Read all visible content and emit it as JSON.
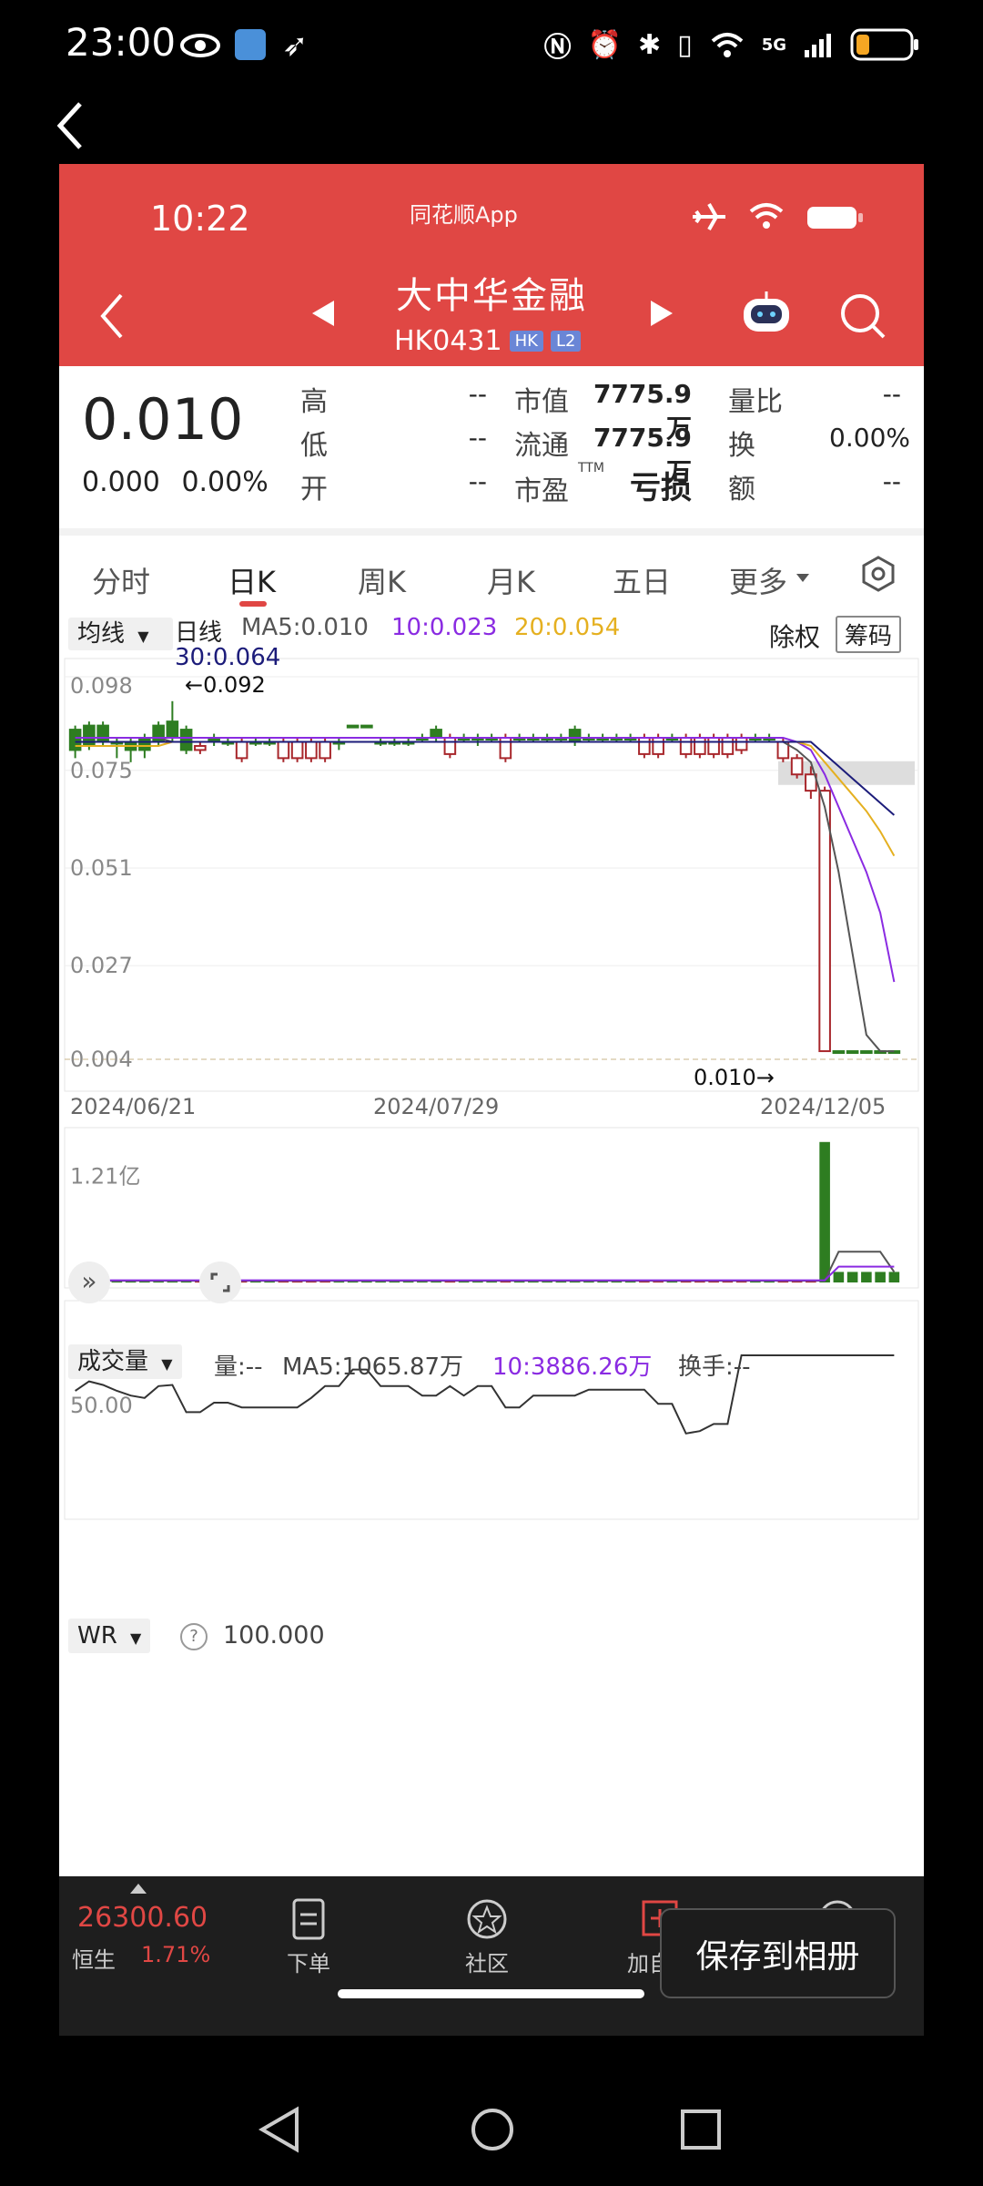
{
  "outer_status": {
    "time": "23:00",
    "network": "5G"
  },
  "inner_status": {
    "time": "10:22",
    "brand": "同花顺App"
  },
  "stock": {
    "name": "大中华金融",
    "code": "HK0431",
    "tag_market": "HK",
    "tag_level": "L2"
  },
  "quote": {
    "price": "0.010",
    "change": "0.000",
    "change_pct": "0.00%",
    "high_label": "高",
    "high_value": "--",
    "low_label": "低",
    "low_value": "--",
    "open_label": "开",
    "open_value": "--",
    "mcap_label": "市值",
    "mcap_value": "7775.9万",
    "float_label": "流通",
    "float_value": "7775.9万",
    "pe_label": "市盈",
    "pe_sup": "TTM",
    "pe_value": "亏损",
    "vr_label": "量比",
    "vr_value": "--",
    "turnover_label": "换",
    "turnover_value": "0.00%",
    "amount_label": "额",
    "amount_value": "--"
  },
  "tabs": [
    {
      "label": "分时"
    },
    {
      "label": "日K"
    },
    {
      "label": "周K"
    },
    {
      "label": "月K"
    },
    {
      "label": "五日"
    },
    {
      "label": "更多"
    }
  ],
  "chart_header": {
    "ma_select": "均线",
    "period": "日线",
    "ma5": "MA5:0.010",
    "ma10": "10:0.023",
    "ma20": "20:0.054",
    "ma30": "30:0.064",
    "exright": "除权",
    "chips": "筹码"
  },
  "vol_header": {
    "select": "成交量",
    "vol": "量:--",
    "ma5": "MA5:1065.87万",
    "ma10": "10:3886.26万",
    "turnover": "换手:--"
  },
  "wr_header": {
    "select": "WR",
    "help": "?",
    "value": "100.000"
  },
  "chart_data": [
    {
      "type": "candlestick",
      "title": "日线",
      "y_ticks": [
        "0.098",
        "0.075",
        "0.051",
        "0.027",
        "0.004"
      ],
      "x_ticks": [
        "2024/06/21",
        "2024/07/29",
        "2024/12/05"
      ],
      "ylim": [
        0.004,
        0.098
      ],
      "annotations": {
        "max": "←0.092",
        "last": "0.010→"
      },
      "candles": [
        {
          "o": 0.08,
          "c": 0.085,
          "h": 0.086,
          "l": 0.078
        },
        {
          "o": 0.081,
          "c": 0.086,
          "h": 0.087,
          "l": 0.08
        },
        {
          "o": 0.082,
          "c": 0.086,
          "h": 0.087,
          "l": 0.081
        },
        {
          "o": 0.082,
          "c": 0.082,
          "h": 0.083,
          "l": 0.078
        },
        {
          "o": 0.08,
          "c": 0.082,
          "h": 0.083,
          "l": 0.077
        },
        {
          "o": 0.08,
          "c": 0.083,
          "h": 0.084,
          "l": 0.078
        },
        {
          "o": 0.082,
          "c": 0.086,
          "h": 0.087,
          "l": 0.081
        },
        {
          "o": 0.083,
          "c": 0.087,
          "h": 0.092,
          "l": 0.082
        },
        {
          "o": 0.08,
          "c": 0.085,
          "h": 0.086,
          "l": 0.079
        },
        {
          "o": 0.081,
          "c": 0.08,
          "h": 0.082,
          "l": 0.079
        },
        {
          "o": 0.082,
          "c": 0.083,
          "h": 0.084,
          "l": 0.081
        },
        {
          "o": 0.082,
          "c": 0.082,
          "h": 0.083,
          "l": 0.081
        },
        {
          "o": 0.082,
          "c": 0.078,
          "h": 0.083,
          "l": 0.077
        },
        {
          "o": 0.082,
          "c": 0.082,
          "h": 0.083,
          "l": 0.081
        },
        {
          "o": 0.082,
          "c": 0.082,
          "h": 0.083,
          "l": 0.081
        },
        {
          "o": 0.082,
          "c": 0.078,
          "h": 0.083,
          "l": 0.077
        },
        {
          "o": 0.082,
          "c": 0.078,
          "h": 0.083,
          "l": 0.077
        },
        {
          "o": 0.082,
          "c": 0.078,
          "h": 0.083,
          "l": 0.077
        },
        {
          "o": 0.082,
          "c": 0.078,
          "h": 0.083,
          "l": 0.077
        },
        {
          "o": 0.082,
          "c": 0.082,
          "h": 0.083,
          "l": 0.08
        },
        {
          "o": 0.086,
          "c": 0.086,
          "h": 0.086,
          "l": 0.086
        },
        {
          "o": 0.086,
          "c": 0.086,
          "h": 0.086,
          "l": 0.086
        },
        {
          "o": 0.082,
          "c": 0.082,
          "h": 0.083,
          "l": 0.081
        },
        {
          "o": 0.082,
          "c": 0.082,
          "h": 0.083,
          "l": 0.081
        },
        {
          "o": 0.082,
          "c": 0.082,
          "h": 0.083,
          "l": 0.081
        },
        {
          "o": 0.083,
          "c": 0.083,
          "h": 0.084,
          "l": 0.082
        },
        {
          "o": 0.083,
          "c": 0.085,
          "h": 0.086,
          "l": 0.082
        },
        {
          "o": 0.083,
          "c": 0.079,
          "h": 0.084,
          "l": 0.078
        },
        {
          "o": 0.083,
          "c": 0.083,
          "h": 0.084,
          "l": 0.082
        },
        {
          "o": 0.083,
          "c": 0.083,
          "h": 0.084,
          "l": 0.081
        },
        {
          "o": 0.083,
          "c": 0.083,
          "h": 0.084,
          "l": 0.082
        },
        {
          "o": 0.083,
          "c": 0.078,
          "h": 0.084,
          "l": 0.077
        },
        {
          "o": 0.083,
          "c": 0.083,
          "h": 0.084,
          "l": 0.082
        },
        {
          "o": 0.083,
          "c": 0.083,
          "h": 0.084,
          "l": 0.082
        },
        {
          "o": 0.083,
          "c": 0.083,
          "h": 0.084,
          "l": 0.082
        },
        {
          "o": 0.083,
          "c": 0.083,
          "h": 0.084,
          "l": 0.082
        },
        {
          "o": 0.082,
          "c": 0.085,
          "h": 0.086,
          "l": 0.081
        },
        {
          "o": 0.083,
          "c": 0.083,
          "h": 0.084,
          "l": 0.082
        },
        {
          "o": 0.083,
          "c": 0.083,
          "h": 0.084,
          "l": 0.082
        },
        {
          "o": 0.083,
          "c": 0.083,
          "h": 0.084,
          "l": 0.082
        },
        {
          "o": 0.083,
          "c": 0.083,
          "h": 0.084,
          "l": 0.082
        },
        {
          "o": 0.083,
          "c": 0.079,
          "h": 0.084,
          "l": 0.078
        },
        {
          "o": 0.083,
          "c": 0.079,
          "h": 0.084,
          "l": 0.078
        },
        {
          "o": 0.083,
          "c": 0.083,
          "h": 0.084,
          "l": 0.082
        },
        {
          "o": 0.083,
          "c": 0.079,
          "h": 0.084,
          "l": 0.078
        },
        {
          "o": 0.083,
          "c": 0.079,
          "h": 0.084,
          "l": 0.078
        },
        {
          "o": 0.083,
          "c": 0.079,
          "h": 0.084,
          "l": 0.078
        },
        {
          "o": 0.083,
          "c": 0.079,
          "h": 0.084,
          "l": 0.078
        },
        {
          "o": 0.083,
          "c": 0.08,
          "h": 0.084,
          "l": 0.079
        },
        {
          "o": 0.083,
          "c": 0.083,
          "h": 0.084,
          "l": 0.082
        },
        {
          "o": 0.083,
          "c": 0.083,
          "h": 0.084,
          "l": 0.082
        },
        {
          "o": 0.082,
          "c": 0.078,
          "h": 0.083,
          "l": 0.077
        },
        {
          "o": 0.078,
          "c": 0.074,
          "h": 0.079,
          "l": 0.073
        },
        {
          "o": 0.074,
          "c": 0.07,
          "h": 0.076,
          "l": 0.068
        },
        {
          "o": 0.07,
          "c": 0.006,
          "h": 0.071,
          "l": 0.006
        },
        {
          "o": 0.006,
          "c": 0.006,
          "h": 0.006,
          "l": 0.006
        },
        {
          "o": 0.006,
          "c": 0.006,
          "h": 0.006,
          "l": 0.006
        },
        {
          "o": 0.006,
          "c": 0.006,
          "h": 0.006,
          "l": 0.006
        },
        {
          "o": 0.006,
          "c": 0.006,
          "h": 0.006,
          "l": 0.006
        },
        {
          "o": 0.006,
          "c": 0.006,
          "h": 0.006,
          "l": 0.006
        }
      ],
      "series": [
        {
          "name": "MA5",
          "values": [
            0.083,
            0.083,
            0.083,
            0.083,
            0.083,
            0.083,
            0.083,
            0.082,
            0.082,
            0.082,
            0.082,
            0.082,
            0.082,
            0.082,
            0.082,
            0.082,
            0.082,
            0.082,
            0.082,
            0.082,
            0.082,
            0.082,
            0.082,
            0.082,
            0.082,
            0.082,
            0.082,
            0.082,
            0.082,
            0.082,
            0.082,
            0.082,
            0.082,
            0.082,
            0.082,
            0.082,
            0.082,
            0.082,
            0.082,
            0.082,
            0.082,
            0.082,
            0.082,
            0.082,
            0.082,
            0.082,
            0.082,
            0.082,
            0.082,
            0.082,
            0.082,
            0.082,
            0.08,
            0.077,
            0.066,
            0.05,
            0.03,
            0.01,
            0.006,
            0.006
          ]
        },
        {
          "name": "10",
          "values": [
            0.083,
            0.083,
            0.083,
            0.083,
            0.083,
            0.083,
            0.083,
            0.083,
            0.083,
            0.083,
            0.083,
            0.083,
            0.083,
            0.083,
            0.083,
            0.083,
            0.083,
            0.083,
            0.083,
            0.083,
            0.083,
            0.083,
            0.083,
            0.083,
            0.083,
            0.083,
            0.083,
            0.083,
            0.083,
            0.083,
            0.083,
            0.083,
            0.083,
            0.083,
            0.083,
            0.083,
            0.083,
            0.083,
            0.083,
            0.083,
            0.083,
            0.083,
            0.083,
            0.083,
            0.083,
            0.083,
            0.083,
            0.083,
            0.083,
            0.083,
            0.083,
            0.083,
            0.082,
            0.08,
            0.074,
            0.066,
            0.058,
            0.05,
            0.04,
            0.023
          ]
        },
        {
          "name": "20",
          "values": [
            0.081,
            0.081,
            0.081,
            0.081,
            0.081,
            0.081,
            0.081,
            0.082,
            0.082,
            0.082,
            0.082,
            0.082,
            0.082,
            0.082,
            0.082,
            0.082,
            0.082,
            0.082,
            0.082,
            0.082,
            0.082,
            0.082,
            0.082,
            0.082,
            0.082,
            0.082,
            0.082,
            0.082,
            0.082,
            0.082,
            0.082,
            0.082,
            0.082,
            0.082,
            0.082,
            0.082,
            0.082,
            0.082,
            0.082,
            0.082,
            0.082,
            0.082,
            0.082,
            0.082,
            0.082,
            0.082,
            0.082,
            0.082,
            0.082,
            0.082,
            0.082,
            0.082,
            0.082,
            0.081,
            0.077,
            0.073,
            0.069,
            0.065,
            0.06,
            0.054
          ]
        },
        {
          "name": "30",
          "values": [
            0.082,
            0.082,
            0.082,
            0.082,
            0.082,
            0.082,
            0.082,
            0.082,
            0.082,
            0.082,
            0.082,
            0.082,
            0.082,
            0.082,
            0.082,
            0.082,
            0.082,
            0.082,
            0.082,
            0.082,
            0.082,
            0.082,
            0.082,
            0.082,
            0.082,
            0.082,
            0.082,
            0.082,
            0.082,
            0.082,
            0.082,
            0.082,
            0.082,
            0.082,
            0.082,
            0.082,
            0.082,
            0.082,
            0.082,
            0.082,
            0.082,
            0.082,
            0.082,
            0.082,
            0.082,
            0.082,
            0.082,
            0.082,
            0.082,
            0.082,
            0.082,
            0.082,
            0.082,
            0.082,
            0.079,
            0.076,
            0.073,
            0.07,
            0.067,
            0.064
          ]
        }
      ]
    },
    {
      "type": "bar",
      "title": "成交量",
      "y_ticks": [
        "1.21亿"
      ],
      "ylim": [
        0,
        1.66
      ]
    },
    {
      "type": "line",
      "title": "WR",
      "y_ticks": [
        "50.00"
      ],
      "ylim": [
        0,
        100
      ],
      "values": [
        70,
        78,
        75,
        70,
        66,
        64,
        74,
        75,
        52,
        52,
        60,
        60,
        56,
        56,
        56,
        56,
        56,
        64,
        74,
        74,
        88,
        88,
        74,
        74,
        74,
        66,
        66,
        74,
        66,
        74,
        74,
        56,
        56,
        66,
        66,
        66,
        66,
        71,
        71,
        71,
        71,
        71,
        59,
        59,
        34,
        36,
        42,
        42,
        100,
        100,
        100,
        100,
        100,
        100,
        100,
        100,
        100,
        100,
        100,
        100
      ]
    }
  ],
  "bottom_nav": {
    "index_value": "26300.60",
    "index_name": "恒生",
    "index_pct": "1.71%",
    "order": "下单",
    "community": "社区",
    "add_watch": "加自选",
    "save": "保存到相册"
  },
  "colors": {
    "red": "#e04744",
    "green": "#2e7d21",
    "ma5": "#555555",
    "ma10": "#8a2be2",
    "ma20": "#e5b020",
    "ma30": "#1c1c7a"
  }
}
